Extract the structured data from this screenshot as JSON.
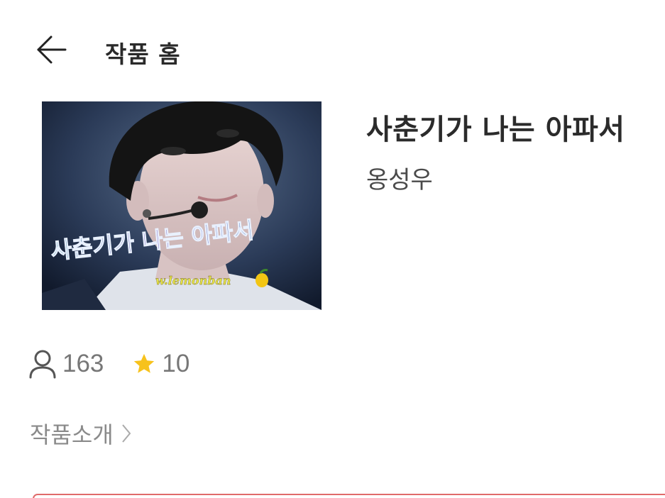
{
  "header": {
    "title": "작품 홈",
    "back_icon": "arrow-left-icon"
  },
  "work": {
    "title": "사춘기가 나는 아파서",
    "author": "옹성우",
    "cover": {
      "overlay_title": "사춘기가 나는 아파서",
      "watermark": "w.lemonban",
      "watermark_icon": "lemon-icon"
    }
  },
  "stats": {
    "readers_icon": "person-icon",
    "readers": "163",
    "stars_icon": "star-icon",
    "stars": "10",
    "star_color": "#f7c21c"
  },
  "intro": {
    "label": "작품소개",
    "icon": "chevron-right-icon"
  },
  "colors": {
    "accent": "#e06b6b"
  }
}
